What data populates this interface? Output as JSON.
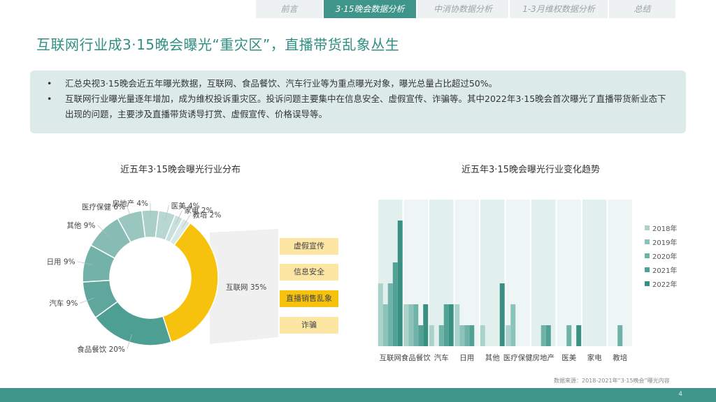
{
  "nav": {
    "tabs": [
      {
        "label": "前言",
        "active": false
      },
      {
        "label": "3·15晚会数据分析",
        "active": true
      },
      {
        "label": "中消协数据分析",
        "active": false
      },
      {
        "label": "1-3月维权数据分析",
        "active": false
      },
      {
        "label": "总结",
        "active": false
      }
    ]
  },
  "page": {
    "title": "互联网行业成3·15晚会曝光“重灾区”，直播带货乱象丛生",
    "bullets": [
      "汇总央视3·15晚会近五年曝光数据，互联网、食品餐饮、汽车行业等为重点曝光对象，曝光总量占比超过50%。",
      "互联网行业曝光量逐年增加，成为维权投诉重灾区。投诉问题主要集中在信息安全、虚假宣传、诈骗等。其中2022年3·15晚会首次曝光了直播带货新业态下出现的问题，主要涉及直播带货诱导打赏、虚假宣传、价格误导等。"
    ],
    "bullet_mark": "•",
    "source": "数据来源：2018-2021年“3·15晚会”曝光内容",
    "page_number": "4"
  },
  "colors": {
    "accent": "#3f958a",
    "highlight": "#f7c20e",
    "callout": "#fde6a4"
  },
  "chart_data": [
    {
      "type": "pie",
      "title": "近五年3·15晚会曝光行业分布",
      "slices": [
        {
          "label": "互联网",
          "value": 35,
          "color": "#f7c20e"
        },
        {
          "label": "食品餐饮",
          "value": 20,
          "color": "#4d9e93"
        },
        {
          "label": "汽车",
          "value": 9,
          "color": "#5fa79c"
        },
        {
          "label": "日用",
          "value": 9,
          "color": "#73b2a8"
        },
        {
          "label": "其他",
          "value": 9,
          "color": "#86bcb3"
        },
        {
          "label": "医疗保健",
          "value": 6,
          "color": "#99c7bf"
        },
        {
          "label": "房地产",
          "value": 4,
          "color": "#a9cfc8"
        },
        {
          "label": "医美",
          "value": 4,
          "color": "#b8d7d2"
        },
        {
          "label": "家电",
          "value": 2,
          "color": "#c8e0dc"
        },
        {
          "label": "教培",
          "value": 2,
          "color": "#d7e8e5"
        }
      ],
      "callouts": [
        {
          "label": "虚假宣传",
          "highlight": false
        },
        {
          "label": "信息安全",
          "highlight": false
        },
        {
          "label": "直播销售乱象",
          "highlight": true
        },
        {
          "label": "诈骗",
          "highlight": false
        }
      ]
    },
    {
      "type": "bar",
      "title": "近五年3·15晚会曝光行业变化趋势",
      "categories": [
        "互联网",
        "食品餐饮",
        "汽车",
        "日用",
        "其他",
        "医疗保健",
        "房地产",
        "医美",
        "家电",
        "教培"
      ],
      "series": [
        {
          "name": "2018年",
          "color": "#a9d2cb",
          "values": [
            3,
            2,
            1,
            2,
            1,
            1,
            0,
            0,
            0,
            0
          ]
        },
        {
          "name": "2019年",
          "color": "#8bc3ba",
          "values": [
            2,
            2,
            0,
            1,
            0,
            2,
            0,
            0,
            0,
            0
          ]
        },
        {
          "name": "2020年",
          "color": "#6fb2a7",
          "values": [
            3,
            2,
            1,
            1,
            0,
            0,
            1,
            1,
            0,
            1
          ]
        },
        {
          "name": "2021年",
          "color": "#52a195",
          "values": [
            4,
            1,
            2,
            1,
            0,
            0,
            1,
            0,
            0,
            0
          ]
        },
        {
          "name": "2022年",
          "color": "#3a8f83",
          "values": [
            6,
            2,
            2,
            0,
            3,
            0,
            0,
            1,
            0,
            0
          ]
        }
      ],
      "ylim": [
        0,
        7
      ],
      "grid": false,
      "legend": "right"
    }
  ]
}
